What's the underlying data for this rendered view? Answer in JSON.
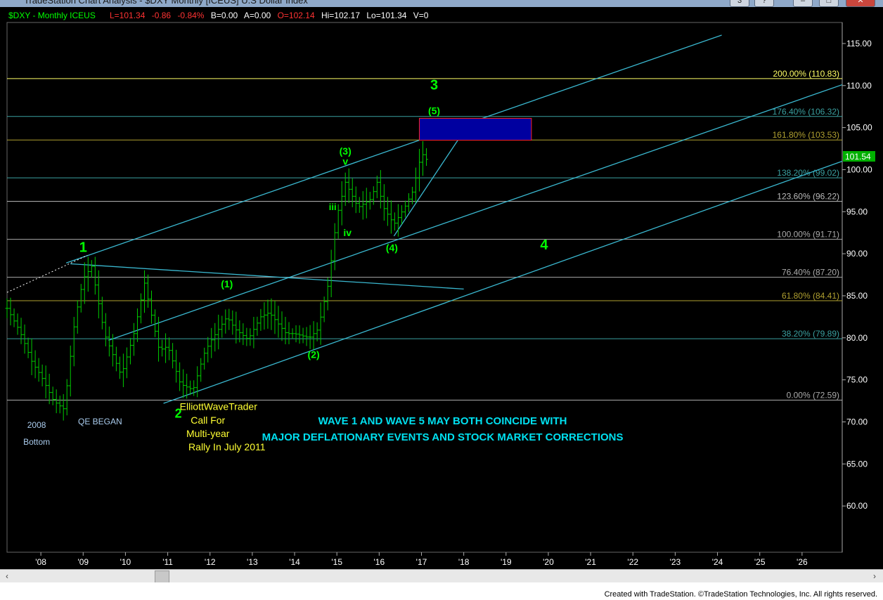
{
  "window": {
    "title": "TradeStation Chart Analysis - $DXY Monthly [ICEUS] U.S Dollar Index",
    "buttons": [
      "3",
      "?",
      "–",
      "□",
      "✕"
    ]
  },
  "header": {
    "symbol": "$DXY - Monthly  ICEUS",
    "last": "L=101.34",
    "change": "-0.86",
    "change_pct": "-0.84%",
    "bid": "B=0.00",
    "ask": "A=0.00",
    "open": "O=102.14",
    "high": "Hi=102.17",
    "low": "Lo=101.34",
    "volume": "V=0"
  },
  "footer": {
    "credit": "Created with TradeStation. ©TradeStation Technologies, Inc. All rights reserved."
  },
  "chart_data": {
    "type": "bar",
    "title": "$DXY - Monthly  ICEUS",
    "ylim": [
      54.5,
      117.5
    ],
    "xlim": [
      2007.2,
      2026.95
    ],
    "y_ticks": [
      "115.00",
      "110.00",
      "105.00",
      "100.00",
      "95.00",
      "90.00",
      "85.00",
      "80.00",
      "75.00",
      "70.00",
      "65.00",
      "60.00"
    ],
    "y_tick_values": [
      115,
      110,
      105,
      100,
      95,
      90,
      85,
      80,
      75,
      70,
      65,
      60
    ],
    "x_ticks": [
      "'08",
      "'09",
      "'10",
      "'11",
      "'12",
      "'13",
      "'14",
      "'15",
      "'16",
      "'17",
      "'18",
      "'19",
      "'20",
      "'21",
      "'22",
      "'23",
      "'24",
      "'25",
      "'26"
    ],
    "x_tick_values": [
      2008,
      2009,
      2010,
      2011,
      2012,
      2013,
      2014,
      2015,
      2016,
      2017,
      2018,
      2019,
      2020,
      2021,
      2022,
      2023,
      2024,
      2025,
      2026
    ],
    "last_price": "101.54",
    "last_value": 101.54,
    "bar_color": "#00cc00",
    "price_path": [
      [
        2007.2,
        83.5
      ],
      [
        2007.5,
        80.8
      ],
      [
        2007.8,
        77.0
      ],
      [
        2008.0,
        75.5
      ],
      [
        2008.3,
        72.5
      ],
      [
        2008.55,
        71.5
      ],
      [
        2008.8,
        82.0
      ],
      [
        2009.0,
        87.0
      ],
      [
        2009.2,
        88.5
      ],
      [
        2009.5,
        80.5
      ],
      [
        2009.9,
        75.5
      ],
      [
        2010.2,
        80.5
      ],
      [
        2010.45,
        86.5
      ],
      [
        2010.8,
        78.5
      ],
      [
        2011.0,
        79.0
      ],
      [
        2011.3,
        74.5
      ],
      [
        2011.6,
        73.8
      ],
      [
        2011.85,
        78.0
      ],
      [
        2012.0,
        79.5
      ],
      [
        2012.4,
        82.5
      ],
      [
        2012.6,
        81.0
      ],
      [
        2012.9,
        79.8
      ],
      [
        2013.2,
        82.5
      ],
      [
        2013.4,
        83.0
      ],
      [
        2013.8,
        80.5
      ],
      [
        2014.0,
        80.5
      ],
      [
        2014.35,
        80.0
      ],
      [
        2014.55,
        81.0
      ],
      [
        2014.8,
        86.5
      ],
      [
        2015.0,
        94.5
      ],
      [
        2015.2,
        98.5
      ],
      [
        2015.5,
        95.5
      ],
      [
        2015.8,
        96.5
      ],
      [
        2015.95,
        98.5
      ],
      [
        2016.1,
        95.5
      ],
      [
        2016.35,
        93.5
      ],
      [
        2016.6,
        95.5
      ],
      [
        2016.8,
        97.5
      ],
      [
        2017.0,
        102.0
      ],
      [
        2017.15,
        101.0
      ]
    ],
    "fib_levels": [
      {
        "label": "200.00% (110.83)",
        "value": 110.83,
        "color": "#ffff66"
      },
      {
        "label": "176.40% (106.32)",
        "value": 106.32,
        "color": "#3aa0a0"
      },
      {
        "label": "161.80% (103.53)",
        "value": 103.53,
        "color": "#b0a030"
      },
      {
        "label": "138.20% (99.02)",
        "value": 99.02,
        "color": "#3aa0a0"
      },
      {
        "label": "123.60% (96.22)",
        "value": 96.22,
        "color": "#bbbbbb"
      },
      {
        "label": "100.00% (91.71)",
        "value": 91.71,
        "color": "#aaaaaa"
      },
      {
        "label": "76.40% (87.20)",
        "value": 87.2,
        "color": "#aaaaaa"
      },
      {
        "label": "61.80% (84.41)",
        "value": 84.41,
        "color": "#b0a030"
      },
      {
        "label": "38.20% (79.89)",
        "value": 79.89,
        "color": "#3aa0a0"
      },
      {
        "label": "0.00% (72.59)",
        "value": 72.59,
        "color": "#aaaaaa"
      }
    ],
    "channel_lines": [
      {
        "from": [
          2008.6,
          88.9
        ],
        "to": [
          2024.1,
          116.0
        ],
        "color": "#3ab8d0"
      },
      {
        "from": [
          2009.6,
          79.7
        ],
        "to": [
          2026.95,
          110.1
        ],
        "color": "#3ab8d0"
      },
      {
        "from": [
          2010.9,
          72.2
        ],
        "to": [
          2026.95,
          101.0
        ],
        "color": "#3ab8d0"
      },
      {
        "from": [
          2008.7,
          88.8
        ],
        "to": [
          2018.0,
          85.8
        ],
        "color": "#3ab8d0"
      },
      {
        "from": [
          2016.35,
          92.1
        ],
        "to": [
          2017.9,
          103.8
        ],
        "color": "#3ab8d0"
      }
    ],
    "dotted_line": {
      "from": [
        2007.2,
        85.4
      ],
      "to": [
        2009.1,
        89.8
      ],
      "color": "#ffffff"
    },
    "target_box": {
      "x0": 2016.95,
      "x1": 2019.6,
      "y0": 103.5,
      "y1": 106.1,
      "fill": "#0000a0",
      "stroke": "#ff2222"
    },
    "wave_labels": [
      {
        "text": "1",
        "x": 2009.0,
        "y": 90.2,
        "color": "#00ff00",
        "size": 20
      },
      {
        "text": "2",
        "x": 2011.25,
        "y": 70.5,
        "color": "#00ff00",
        "size": 18
      },
      {
        "text": "3",
        "x": 2017.3,
        "y": 109.5,
        "color": "#00ff00",
        "size": 20
      },
      {
        "text": "4",
        "x": 2019.9,
        "y": 90.5,
        "color": "#00ff00",
        "size": 20
      },
      {
        "text": "(1)",
        "x": 2012.4,
        "y": 86.0,
        "color": "#00ff00",
        "size": 14
      },
      {
        "text": "(2)",
        "x": 2014.45,
        "y": 77.6,
        "color": "#00ff00",
        "size": 14
      },
      {
        "text": "(3)",
        "x": 2015.2,
        "y": 101.8,
        "color": "#00ff00",
        "size": 14
      },
      {
        "text": "(4)",
        "x": 2016.3,
        "y": 90.3,
        "color": "#00ff00",
        "size": 14
      },
      {
        "text": "(5)",
        "x": 2017.3,
        "y": 106.6,
        "color": "#00ff00",
        "size": 14
      },
      {
        "text": "v",
        "x": 2015.2,
        "y": 100.6,
        "color": "#00ff00",
        "size": 14
      },
      {
        "text": "iii",
        "x": 2014.9,
        "y": 95.2,
        "color": "#00ff00",
        "size": 13
      },
      {
        "text": "iv",
        "x": 2015.25,
        "y": 92.1,
        "color": "#00ff00",
        "size": 14
      }
    ],
    "annotations": [
      {
        "text": "2008",
        "x": 2007.9,
        "y": 69.3,
        "color": "#aaccee",
        "size": 12
      },
      {
        "text": "Bottom",
        "x": 2007.9,
        "y": 67.3,
        "color": "#aaccee",
        "size": 12
      },
      {
        "text": "QE BEGAN",
        "x": 2009.4,
        "y": 69.7,
        "color": "#aaccee",
        "size": 12
      },
      {
        "text": "ElliottWaveTrader",
        "x": 2012.2,
        "y": 71.4,
        "color": "#ffff33",
        "size": 14
      },
      {
        "text": "Call For",
        "x": 2011.95,
        "y": 69.8,
        "color": "#ffff33",
        "size": 14
      },
      {
        "text": "Multi-year",
        "x": 2011.95,
        "y": 68.2,
        "color": "#ffff33",
        "size": 14
      },
      {
        "text": "Rally  In July 2011",
        "x": 2012.4,
        "y": 66.6,
        "color": "#ffff33",
        "size": 14
      },
      {
        "text": "WAVE 1 AND WAVE 5 MAY BOTH COINCIDE WITH",
        "x": 2017.5,
        "y": 69.7,
        "color": "#00e0f0",
        "size": 15
      },
      {
        "text": "MAJOR DEFLATIONARY EVENTS AND STOCK MARKET CORRECTIONS",
        "x": 2017.5,
        "y": 67.8,
        "color": "#00e0f0",
        "size": 15
      }
    ]
  }
}
